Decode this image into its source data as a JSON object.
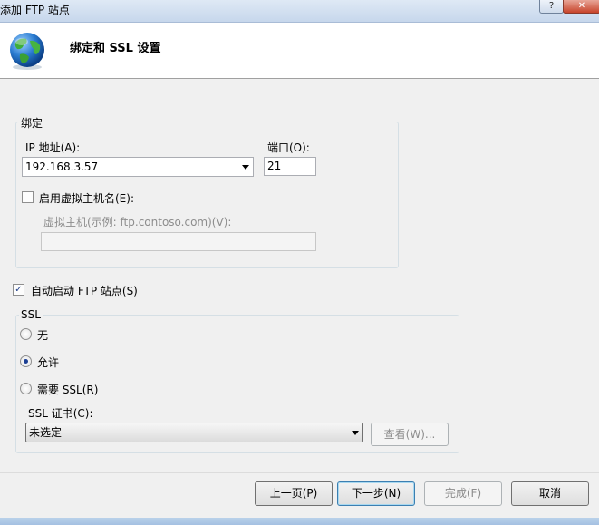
{
  "window": {
    "title": "添加 FTP 站点",
    "help_glyph": "?",
    "close_glyph": "✕"
  },
  "header": {
    "title": "绑定和 SSL 设置",
    "icon": "globe-icon"
  },
  "binding": {
    "legend": "绑定",
    "ip_label": "IP 地址(A):",
    "ip_value": "192.168.3.57",
    "port_label": "端口(O):",
    "port_value": "21",
    "vhost_checkbox_label": "启用虚拟主机名(E):",
    "vhost_checked": false,
    "vhost_label": "虚拟主机(示例: ftp.contoso.com)(V):",
    "vhost_value": ""
  },
  "autostart": {
    "label": "自动启动 FTP 站点(S)",
    "checked": true
  },
  "ssl": {
    "legend": "SSL",
    "options": [
      {
        "label": "无",
        "selected": false
      },
      {
        "label": "允许",
        "selected": true
      },
      {
        "label": "需要 SSL(R)",
        "selected": false
      }
    ],
    "cert_label": "SSL 证书(C):",
    "cert_value": "未选定",
    "view_button": "查看(W)..."
  },
  "footer": {
    "prev_button": "上一页(P)",
    "next_button": "下一步(N)",
    "finish_button": "完成(F)",
    "cancel_button": "取消"
  },
  "colors": {
    "accent": "#1c3f94",
    "window_bg": "#f0f0f0"
  }
}
